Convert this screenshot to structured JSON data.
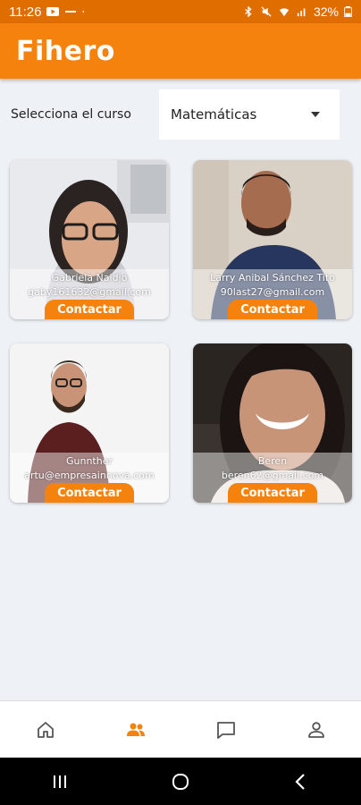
{
  "status_bar": {
    "time": "11:26",
    "battery": "32%"
  },
  "app": {
    "title": "Fihero"
  },
  "course_selector": {
    "label": "Selecciona el curso",
    "selected": "Matemáticas"
  },
  "colors": {
    "accent": "#f5820d",
    "status_bar": "#e06d00",
    "background": "#eef1f5"
  },
  "teachers": [
    {
      "name": "Gabriela Naidjo",
      "email": "gaby161632@gmail.com",
      "button": "Contactar"
    },
    {
      "name": "Larry Anibal Sánchez Tito",
      "email": "90last27@gmail.com",
      "button": "Contactar"
    },
    {
      "name": "Gunnther",
      "email": "artu@empresainnova.com",
      "button": "Contactar"
    },
    {
      "name": "Beren",
      "email": "beren62@gmail.com",
      "button": "Contactar"
    }
  ],
  "bottom_nav": {
    "items": [
      {
        "icon": "home-icon",
        "active": false
      },
      {
        "icon": "people-icon",
        "active": true
      },
      {
        "icon": "chat-icon",
        "active": false
      },
      {
        "icon": "profile-icon",
        "active": false
      }
    ]
  },
  "system_nav": {
    "icons": [
      "recents-icon",
      "home-circle-icon",
      "back-icon"
    ]
  }
}
